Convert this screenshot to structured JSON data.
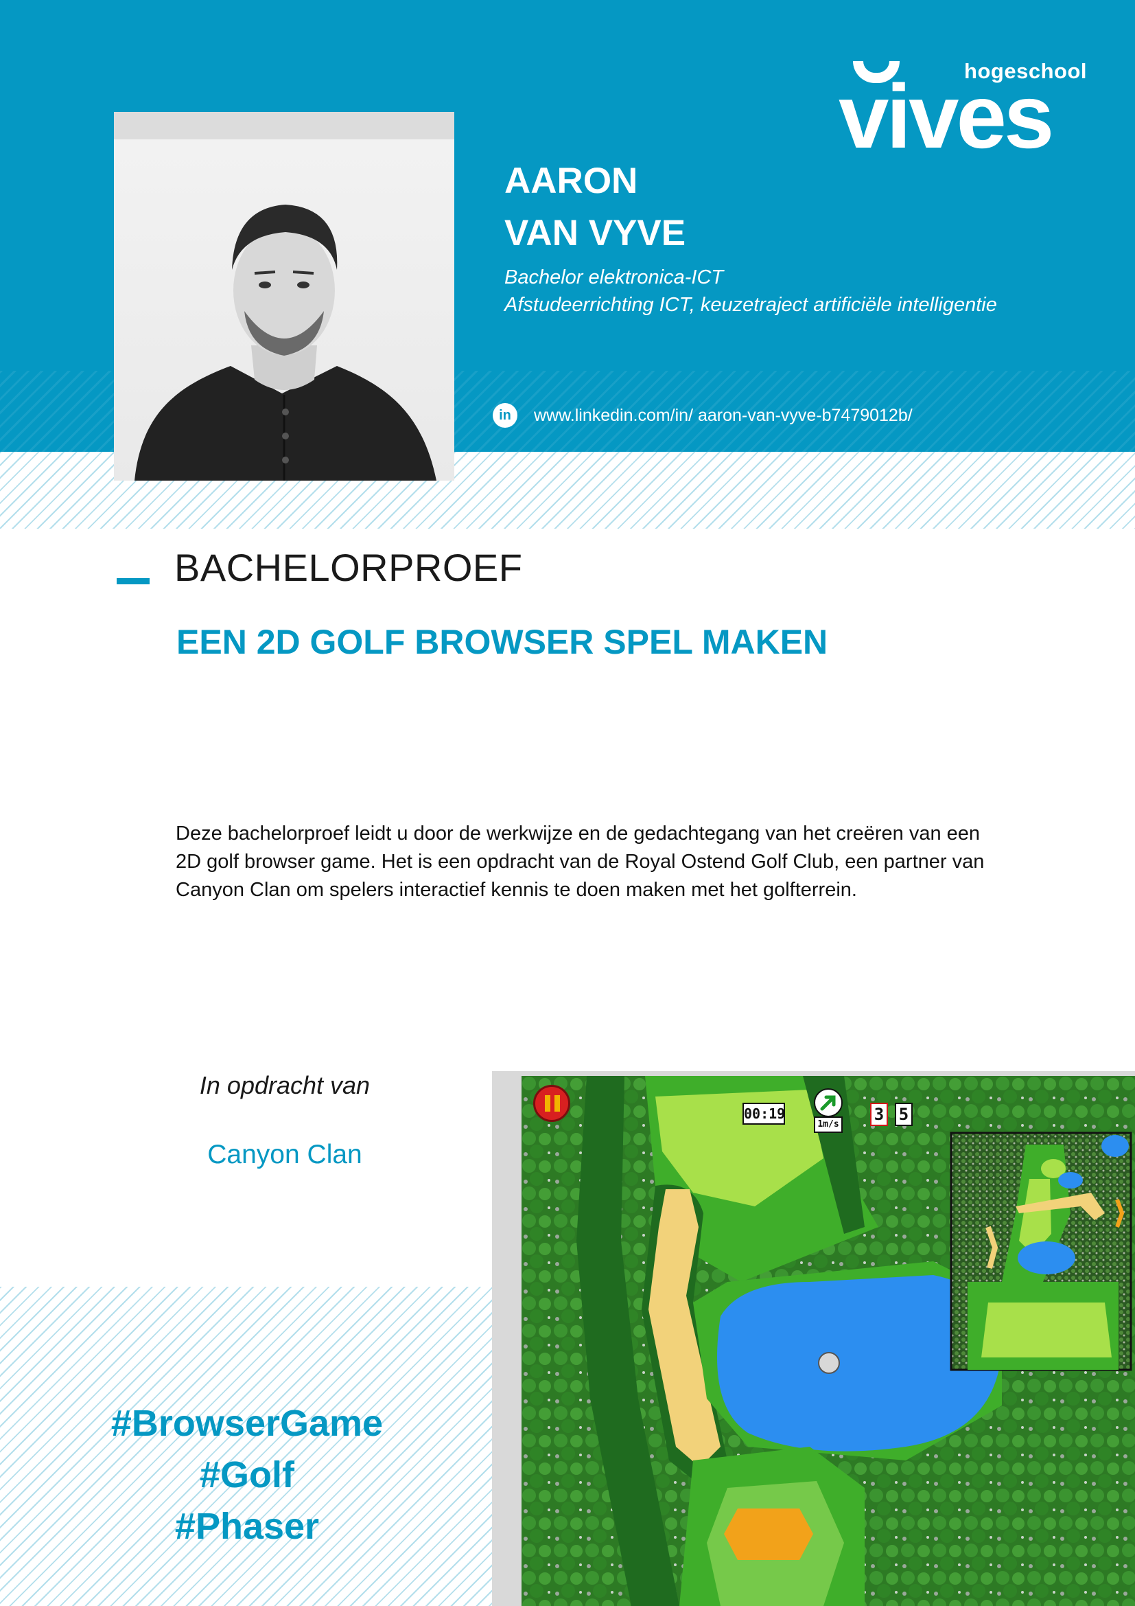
{
  "header": {
    "logo": {
      "small_text": "hogeschool",
      "big_text": "vives"
    },
    "name_first": "AARON",
    "name_last": "VAN VYVE",
    "degree_line1": "Bachelor elektronica-ICT",
    "degree_line2": "Afstudeerrichting ICT, keuzetraject artificiële intelligentie",
    "linkedin": {
      "icon": "linkedin-icon",
      "icon_glyph": "in",
      "url": "www.linkedin.com/in/ aaron-van-vyve-b7479012b/"
    }
  },
  "section": {
    "heading": "BACHELORPROEF",
    "thesis_title": "EEN 2D GOLF BROWSER SPEL MAKEN",
    "summary": "Deze bachelorproef leidt u door de werkwijze en de gedachtegang van het creëren van een 2D golf browser game. Het is een opdracht van de Royal Ostend Golf Club, een partner van Canyon Clan om spelers interactief kennis te doen maken met het golfterrein."
  },
  "commission": {
    "label": "In opdracht van",
    "company": "Canyon Clan"
  },
  "hashtags": [
    "#BrowserGame",
    "#Golf",
    "#Phaser"
  ],
  "game_screenshot": {
    "timer": "00:19",
    "wind_unit": "1m/s",
    "strokes": "3",
    "par": "5",
    "icons": [
      "pause-icon",
      "wind-arrow-icon"
    ]
  },
  "colors": {
    "brand_blue": "#0598c3",
    "text_dark": "#1a1a1a",
    "grass": "#3fae2a",
    "fairway": "#a8e04a",
    "water": "#2c8ef0",
    "sand": "#f2d27a",
    "forest": "#1f6b1f"
  }
}
